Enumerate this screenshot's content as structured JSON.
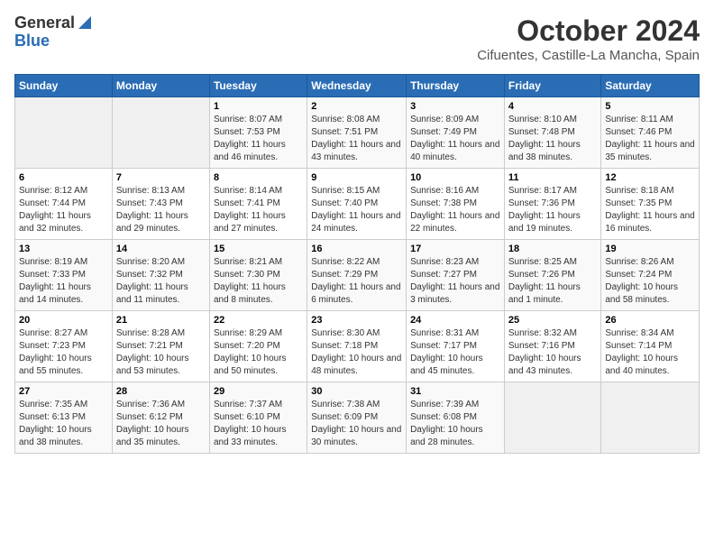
{
  "header": {
    "logo_general": "General",
    "logo_blue": "Blue",
    "month": "October 2024",
    "location": "Cifuentes, Castille-La Mancha, Spain"
  },
  "weekdays": [
    "Sunday",
    "Monday",
    "Tuesday",
    "Wednesday",
    "Thursday",
    "Friday",
    "Saturday"
  ],
  "weeks": [
    [
      {
        "day": "",
        "sunrise": "",
        "sunset": "",
        "daylight": ""
      },
      {
        "day": "",
        "sunrise": "",
        "sunset": "",
        "daylight": ""
      },
      {
        "day": "1",
        "sunrise": "Sunrise: 8:07 AM",
        "sunset": "Sunset: 7:53 PM",
        "daylight": "Daylight: 11 hours and 46 minutes."
      },
      {
        "day": "2",
        "sunrise": "Sunrise: 8:08 AM",
        "sunset": "Sunset: 7:51 PM",
        "daylight": "Daylight: 11 hours and 43 minutes."
      },
      {
        "day": "3",
        "sunrise": "Sunrise: 8:09 AM",
        "sunset": "Sunset: 7:49 PM",
        "daylight": "Daylight: 11 hours and 40 minutes."
      },
      {
        "day": "4",
        "sunrise": "Sunrise: 8:10 AM",
        "sunset": "Sunset: 7:48 PM",
        "daylight": "Daylight: 11 hours and 38 minutes."
      },
      {
        "day": "5",
        "sunrise": "Sunrise: 8:11 AM",
        "sunset": "Sunset: 7:46 PM",
        "daylight": "Daylight: 11 hours and 35 minutes."
      }
    ],
    [
      {
        "day": "6",
        "sunrise": "Sunrise: 8:12 AM",
        "sunset": "Sunset: 7:44 PM",
        "daylight": "Daylight: 11 hours and 32 minutes."
      },
      {
        "day": "7",
        "sunrise": "Sunrise: 8:13 AM",
        "sunset": "Sunset: 7:43 PM",
        "daylight": "Daylight: 11 hours and 29 minutes."
      },
      {
        "day": "8",
        "sunrise": "Sunrise: 8:14 AM",
        "sunset": "Sunset: 7:41 PM",
        "daylight": "Daylight: 11 hours and 27 minutes."
      },
      {
        "day": "9",
        "sunrise": "Sunrise: 8:15 AM",
        "sunset": "Sunset: 7:40 PM",
        "daylight": "Daylight: 11 hours and 24 minutes."
      },
      {
        "day": "10",
        "sunrise": "Sunrise: 8:16 AM",
        "sunset": "Sunset: 7:38 PM",
        "daylight": "Daylight: 11 hours and 22 minutes."
      },
      {
        "day": "11",
        "sunrise": "Sunrise: 8:17 AM",
        "sunset": "Sunset: 7:36 PM",
        "daylight": "Daylight: 11 hours and 19 minutes."
      },
      {
        "day": "12",
        "sunrise": "Sunrise: 8:18 AM",
        "sunset": "Sunset: 7:35 PM",
        "daylight": "Daylight: 11 hours and 16 minutes."
      }
    ],
    [
      {
        "day": "13",
        "sunrise": "Sunrise: 8:19 AM",
        "sunset": "Sunset: 7:33 PM",
        "daylight": "Daylight: 11 hours and 14 minutes."
      },
      {
        "day": "14",
        "sunrise": "Sunrise: 8:20 AM",
        "sunset": "Sunset: 7:32 PM",
        "daylight": "Daylight: 11 hours and 11 minutes."
      },
      {
        "day": "15",
        "sunrise": "Sunrise: 8:21 AM",
        "sunset": "Sunset: 7:30 PM",
        "daylight": "Daylight: 11 hours and 8 minutes."
      },
      {
        "day": "16",
        "sunrise": "Sunrise: 8:22 AM",
        "sunset": "Sunset: 7:29 PM",
        "daylight": "Daylight: 11 hours and 6 minutes."
      },
      {
        "day": "17",
        "sunrise": "Sunrise: 8:23 AM",
        "sunset": "Sunset: 7:27 PM",
        "daylight": "Daylight: 11 hours and 3 minutes."
      },
      {
        "day": "18",
        "sunrise": "Sunrise: 8:25 AM",
        "sunset": "Sunset: 7:26 PM",
        "daylight": "Daylight: 11 hours and 1 minute."
      },
      {
        "day": "19",
        "sunrise": "Sunrise: 8:26 AM",
        "sunset": "Sunset: 7:24 PM",
        "daylight": "Daylight: 10 hours and 58 minutes."
      }
    ],
    [
      {
        "day": "20",
        "sunrise": "Sunrise: 8:27 AM",
        "sunset": "Sunset: 7:23 PM",
        "daylight": "Daylight: 10 hours and 55 minutes."
      },
      {
        "day": "21",
        "sunrise": "Sunrise: 8:28 AM",
        "sunset": "Sunset: 7:21 PM",
        "daylight": "Daylight: 10 hours and 53 minutes."
      },
      {
        "day": "22",
        "sunrise": "Sunrise: 8:29 AM",
        "sunset": "Sunset: 7:20 PM",
        "daylight": "Daylight: 10 hours and 50 minutes."
      },
      {
        "day": "23",
        "sunrise": "Sunrise: 8:30 AM",
        "sunset": "Sunset: 7:18 PM",
        "daylight": "Daylight: 10 hours and 48 minutes."
      },
      {
        "day": "24",
        "sunrise": "Sunrise: 8:31 AM",
        "sunset": "Sunset: 7:17 PM",
        "daylight": "Daylight: 10 hours and 45 minutes."
      },
      {
        "day": "25",
        "sunrise": "Sunrise: 8:32 AM",
        "sunset": "Sunset: 7:16 PM",
        "daylight": "Daylight: 10 hours and 43 minutes."
      },
      {
        "day": "26",
        "sunrise": "Sunrise: 8:34 AM",
        "sunset": "Sunset: 7:14 PM",
        "daylight": "Daylight: 10 hours and 40 minutes."
      }
    ],
    [
      {
        "day": "27",
        "sunrise": "Sunrise: 7:35 AM",
        "sunset": "Sunset: 6:13 PM",
        "daylight": "Daylight: 10 hours and 38 minutes."
      },
      {
        "day": "28",
        "sunrise": "Sunrise: 7:36 AM",
        "sunset": "Sunset: 6:12 PM",
        "daylight": "Daylight: 10 hours and 35 minutes."
      },
      {
        "day": "29",
        "sunrise": "Sunrise: 7:37 AM",
        "sunset": "Sunset: 6:10 PM",
        "daylight": "Daylight: 10 hours and 33 minutes."
      },
      {
        "day": "30",
        "sunrise": "Sunrise: 7:38 AM",
        "sunset": "Sunset: 6:09 PM",
        "daylight": "Daylight: 10 hours and 30 minutes."
      },
      {
        "day": "31",
        "sunrise": "Sunrise: 7:39 AM",
        "sunset": "Sunset: 6:08 PM",
        "daylight": "Daylight: 10 hours and 28 minutes."
      },
      {
        "day": "",
        "sunrise": "",
        "sunset": "",
        "daylight": ""
      },
      {
        "day": "",
        "sunrise": "",
        "sunset": "",
        "daylight": ""
      }
    ]
  ]
}
